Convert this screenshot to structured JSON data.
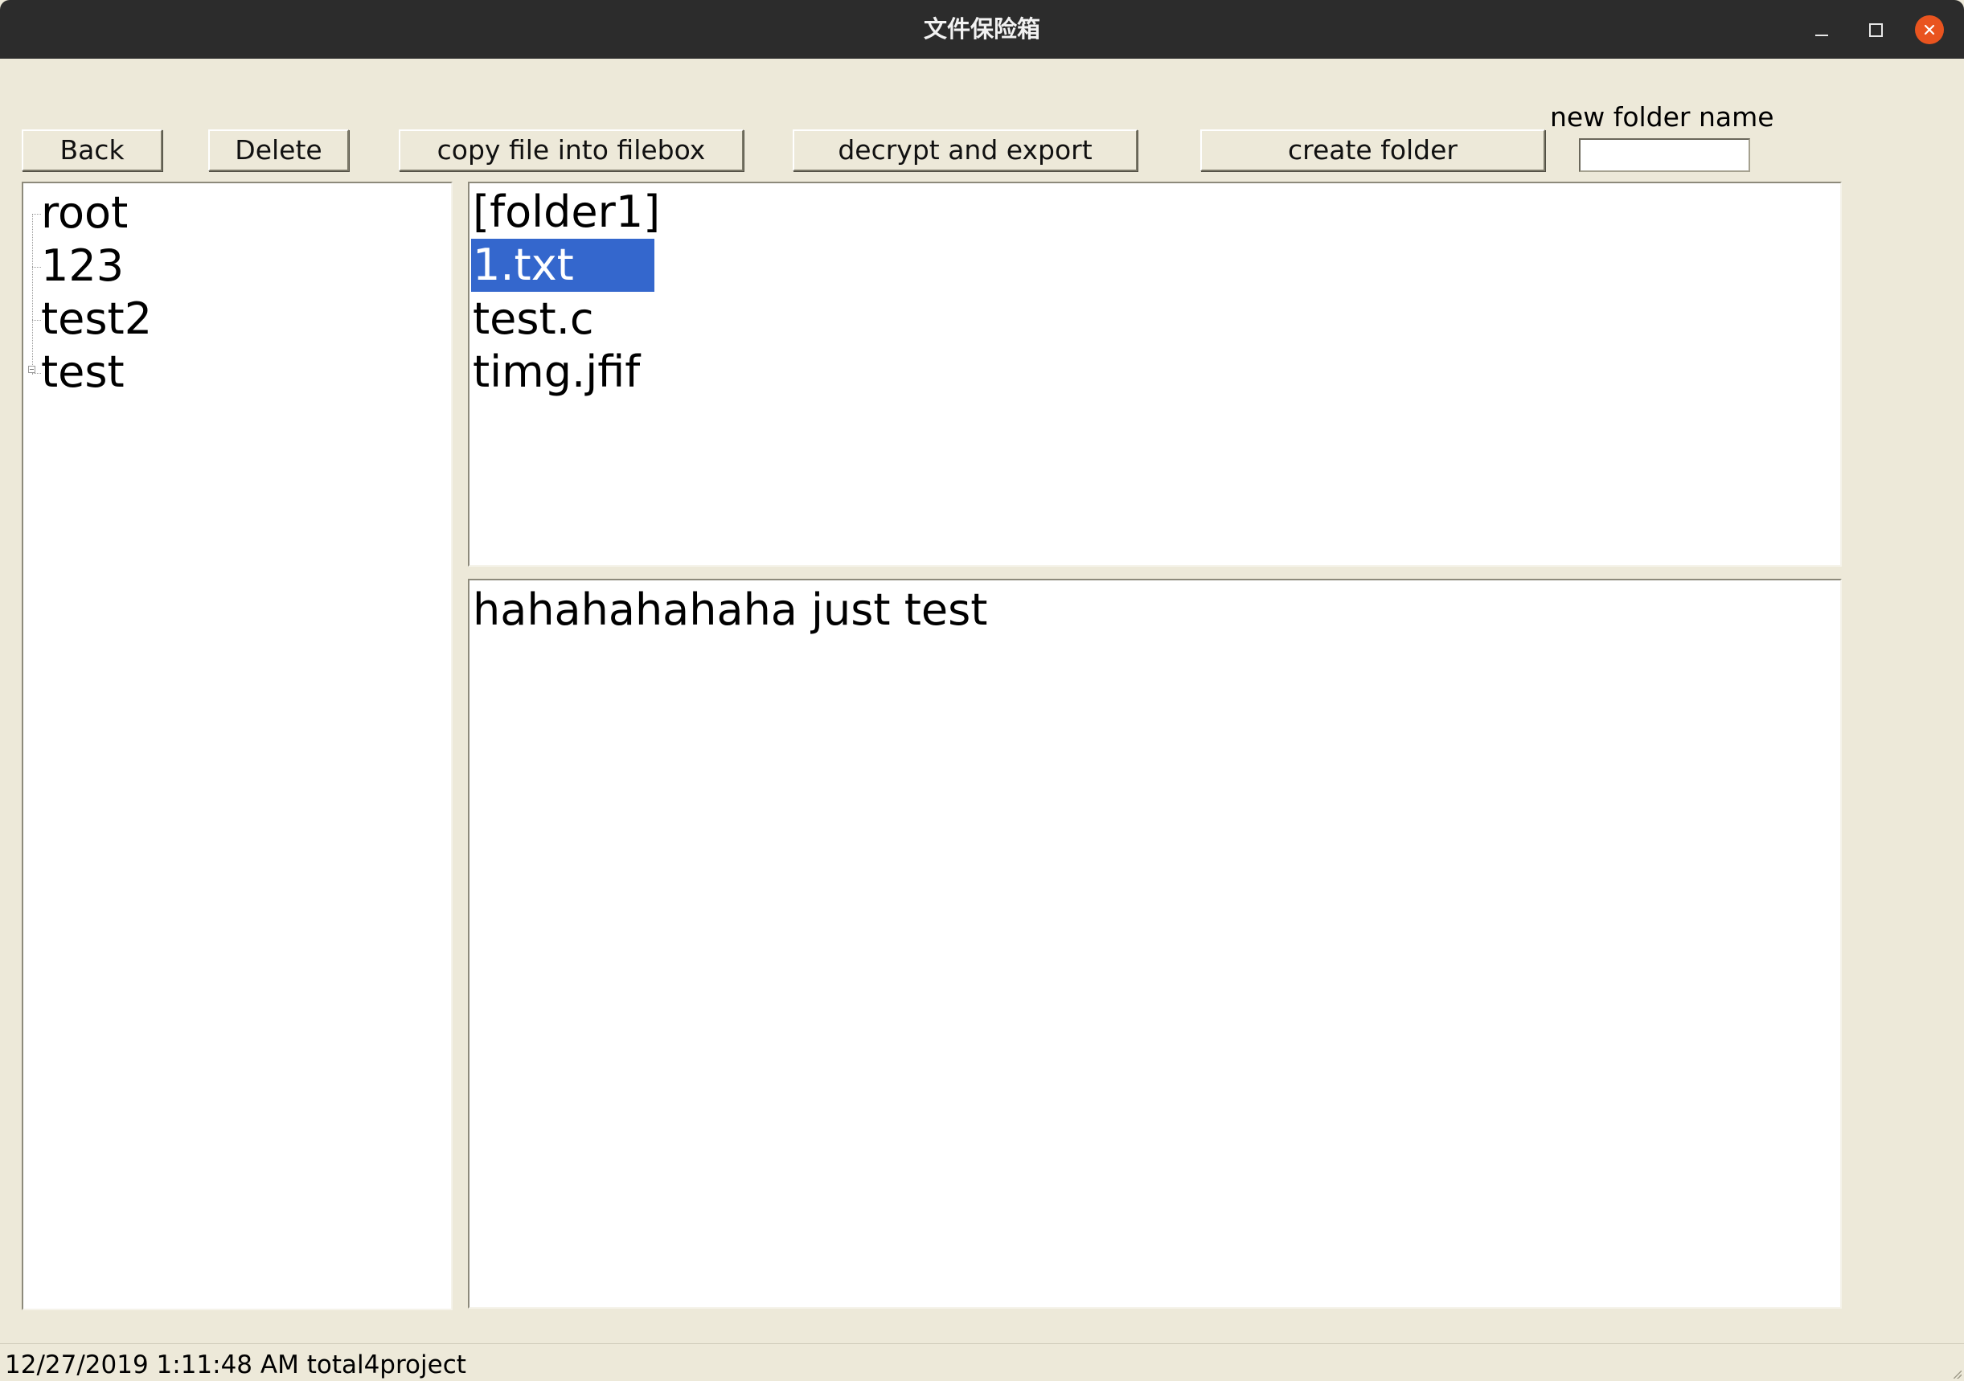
{
  "window": {
    "title": "文件保险箱"
  },
  "toolbar": {
    "back_label": "Back",
    "delete_label": "Delete",
    "copy_label": "copy file into filebox",
    "decrypt_label": "decrypt and export",
    "create_folder_label": "create folder",
    "new_folder_label": "new folder name",
    "new_folder_value": ""
  },
  "tree": {
    "items": [
      {
        "label": "root"
      },
      {
        "label": "123"
      },
      {
        "label": "test2"
      },
      {
        "label": "test",
        "expandable": true
      }
    ]
  },
  "files": {
    "items": [
      {
        "label": "[folder1]",
        "selected": false
      },
      {
        "label": "1.txt",
        "selected": true
      },
      {
        "label": "test.c",
        "selected": false
      },
      {
        "label": "timg.jfif",
        "selected": false
      }
    ]
  },
  "content": {
    "text": "hahahahahaha just test"
  },
  "status": {
    "text": "12/27/2019 1:11:48 AM total4project"
  },
  "colors": {
    "selection": "#3467cd",
    "background": "#ede9d9",
    "titlebar": "#2c2c2c",
    "close_button": "#e9541f"
  }
}
